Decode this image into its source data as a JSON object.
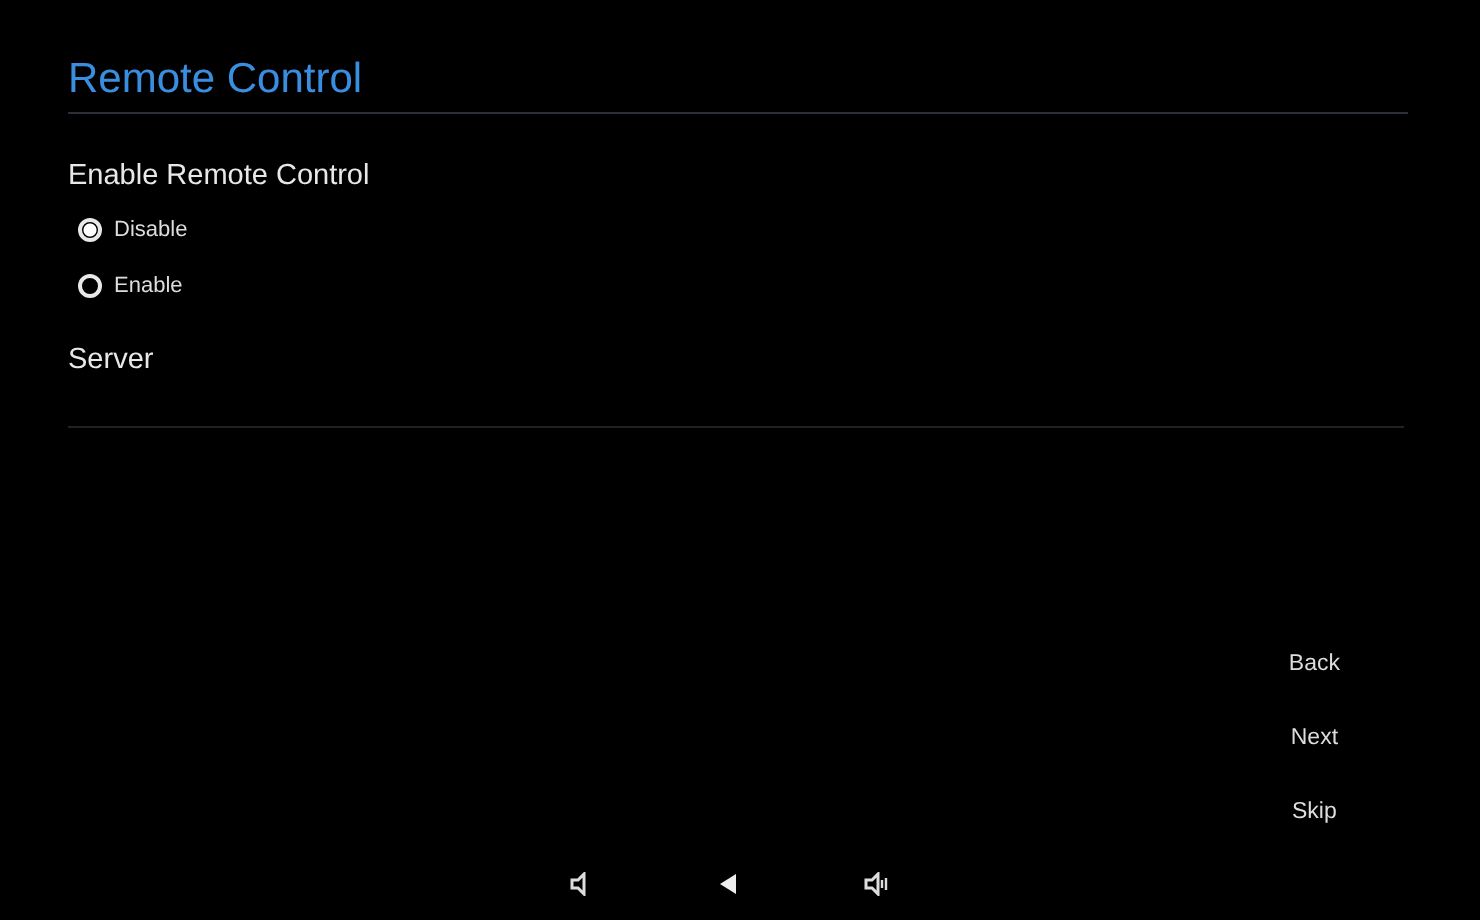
{
  "title": "Remote Control",
  "enable_section": {
    "label": "Enable Remote Control",
    "options": [
      {
        "label": "Disable",
        "selected": true
      },
      {
        "label": "Enable",
        "selected": false
      }
    ]
  },
  "server": {
    "label": "Server"
  },
  "buttons": [
    "Back",
    "Next",
    "Skip"
  ]
}
